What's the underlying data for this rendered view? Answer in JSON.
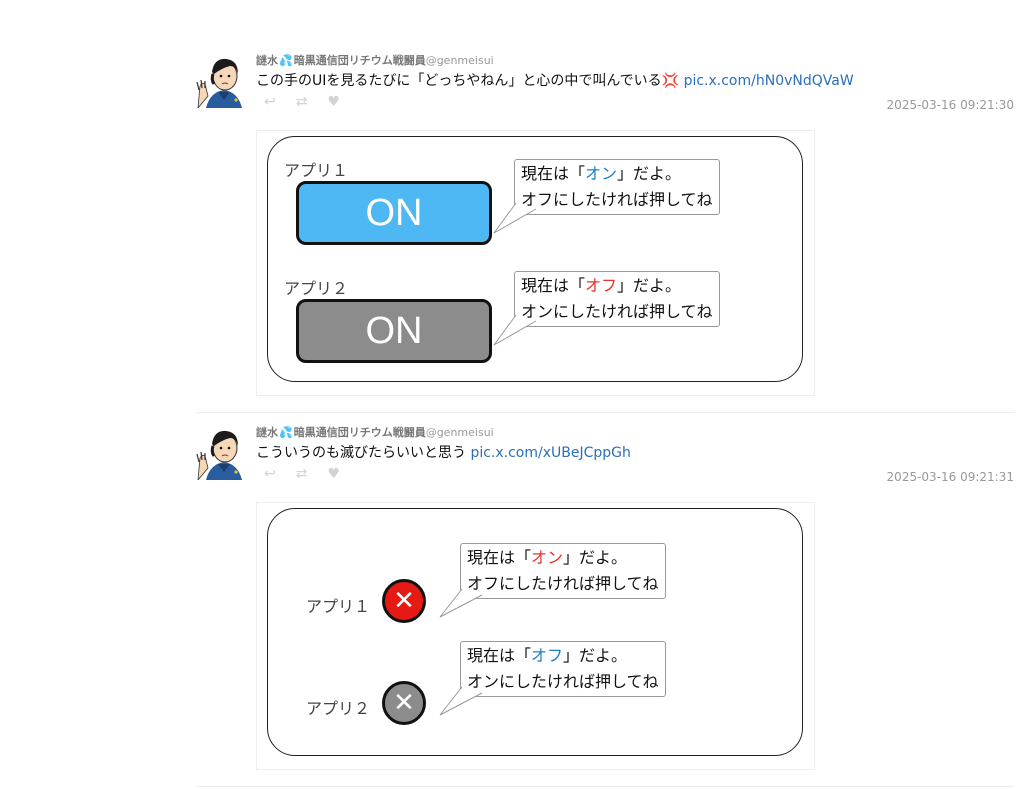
{
  "tweets": [
    {
      "username": "謎水",
      "username_drop": "💦",
      "username_rest": "暗黒通信団リチウム戦闘員",
      "handle": "@genmeisui",
      "text": "この手のUIを見るたびに「どっちやねん」と心の中で叫んでいる",
      "anger_emoji": "💢",
      "link": "pic.x.com/hN0vNdQVaW",
      "timestamp": "2025-03-16 09:21:30",
      "image": {
        "app1_label": "アプリ１",
        "app1_button": "ON",
        "app1_button_color": "#4db8f3",
        "app1_bubble_prefix": "現在は「",
        "app1_bubble_state": "オン",
        "app1_bubble_state_color": "#1a80c8",
        "app1_bubble_suffix": "」だよ。",
        "app1_bubble_line2": "オフにしたければ押してね",
        "app2_label": "アプリ２",
        "app2_button": "ON",
        "app2_button_color": "#8c8c8c",
        "app2_bubble_prefix": "現在は「",
        "app2_bubble_state": "オフ",
        "app2_bubble_state_color": "#e8322a",
        "app2_bubble_suffix": "」だよ。",
        "app2_bubble_line2": "オンにしたければ押してね"
      }
    },
    {
      "username": "謎水",
      "username_drop": "💦",
      "username_rest": "暗黒通信団リチウム戦闘員",
      "handle": "@genmeisui",
      "text": "こういうのも滅びたらいいと思う",
      "link": "pic.x.com/xUBeJCppGh",
      "timestamp": "2025-03-16 09:21:31",
      "image": {
        "app1_label": "アプリ１",
        "app1_icon": "✕",
        "app1_icon_color": "#e61a14",
        "app1_bubble_prefix": "現在は「",
        "app1_bubble_state": "オン",
        "app1_bubble_state_color": "#e8322a",
        "app1_bubble_suffix": "」だよ。",
        "app1_bubble_line2": "オフにしたければ押してね",
        "app2_label": "アプリ２",
        "app2_icon": "✕",
        "app2_icon_color": "#8c8c8c",
        "app2_bubble_prefix": "現在は「",
        "app2_bubble_state": "オフ",
        "app2_bubble_state_color": "#1a80c8",
        "app2_bubble_suffix": "」だよ。",
        "app2_bubble_line2": "オンにしたければ押してね"
      }
    }
  ],
  "icons": {
    "reply": "reply-icon",
    "retweet": "retweet-icon",
    "like": "heart-icon"
  }
}
